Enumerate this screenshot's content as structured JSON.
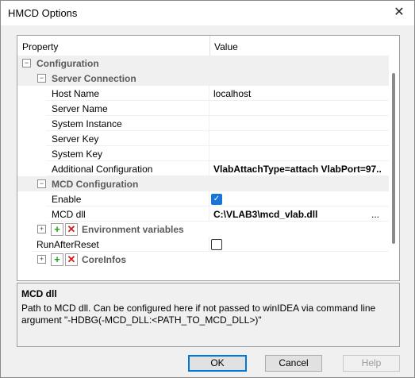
{
  "window": {
    "title": "HMCD Options",
    "close_icon": "close-icon"
  },
  "grid": {
    "header": {
      "property": "Property",
      "value": "Value"
    },
    "configuration": {
      "label": "Configuration",
      "server_connection": {
        "label": "Server Connection",
        "host_name": {
          "name": "Host Name",
          "value": "localhost"
        },
        "server_name": {
          "name": "Server Name",
          "value": ""
        },
        "system_instance": {
          "name": "System Instance",
          "value": ""
        },
        "server_key": {
          "name": "Server Key",
          "value": ""
        },
        "system_key": {
          "name": "System Key",
          "value": ""
        },
        "additional_configuration": {
          "name": "Additional Configuration",
          "value": "VlabAttachType=attach VlabPort=97..."
        }
      },
      "mcd_configuration": {
        "label": "MCD Configuration",
        "enable": {
          "name": "Enable",
          "checked": true
        },
        "mcd_dll": {
          "name": "MCD dll",
          "value": "C:\\VLAB3\\mcd_vlab.dll",
          "browse": "..."
        },
        "environment_variables": {
          "label": "Environment variables"
        }
      },
      "run_after_reset": {
        "name": "RunAfterReset",
        "checked": false
      },
      "core_infos": {
        "label": "CoreInfos"
      }
    }
  },
  "description": {
    "title": "MCD dll",
    "text": "Path to MCD dll. Can be configured here if not passed to winIDEA via command line argument \"-HDBG(-MCD_DLL:<PATH_TO_MCD_DLL>)\""
  },
  "buttons": {
    "ok": "OK",
    "cancel": "Cancel",
    "help": "Help"
  }
}
